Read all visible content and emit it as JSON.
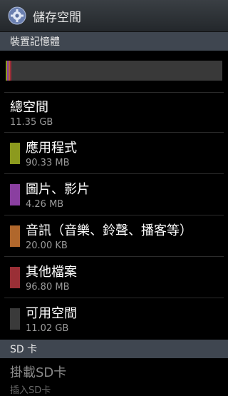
{
  "header": {
    "title": "儲存空間",
    "icon": "gear-icon"
  },
  "device_section": {
    "title": "裝置記憶體"
  },
  "usage_bar": {
    "segments": [
      {
        "name": "apps",
        "fraction": 0.008,
        "color": "#8c9a1e"
      },
      {
        "name": "media",
        "fraction": 0.006,
        "color": "#8a3fa0"
      },
      {
        "name": "audio",
        "fraction": 0.006,
        "color": "#b0672c"
      },
      {
        "name": "other",
        "fraction": 0.008,
        "color": "#9a2f36"
      }
    ],
    "free_color": "#393939"
  },
  "total": {
    "label": "總空間",
    "value": "11.35 GB"
  },
  "items": [
    {
      "label": "應用程式",
      "value": "90.33 MB",
      "color": "#8c9a1e"
    },
    {
      "label": "圖片、影片",
      "value": "4.26 MB",
      "color": "#8a3fa0"
    },
    {
      "label": "音訊（音樂、鈴聲、播客等）",
      "value": "20.00 KB",
      "color": "#b0672c"
    },
    {
      "label": "其他檔案",
      "value": "96.80 MB",
      "color": "#9a2f36"
    },
    {
      "label": "可用空間",
      "value": "11.02 GB",
      "color": "#3a3a3a"
    }
  ],
  "sd_section": {
    "title": "SD 卡"
  },
  "sd_mount": {
    "label": "掛載SD卡",
    "value": "插入SD卡"
  }
}
